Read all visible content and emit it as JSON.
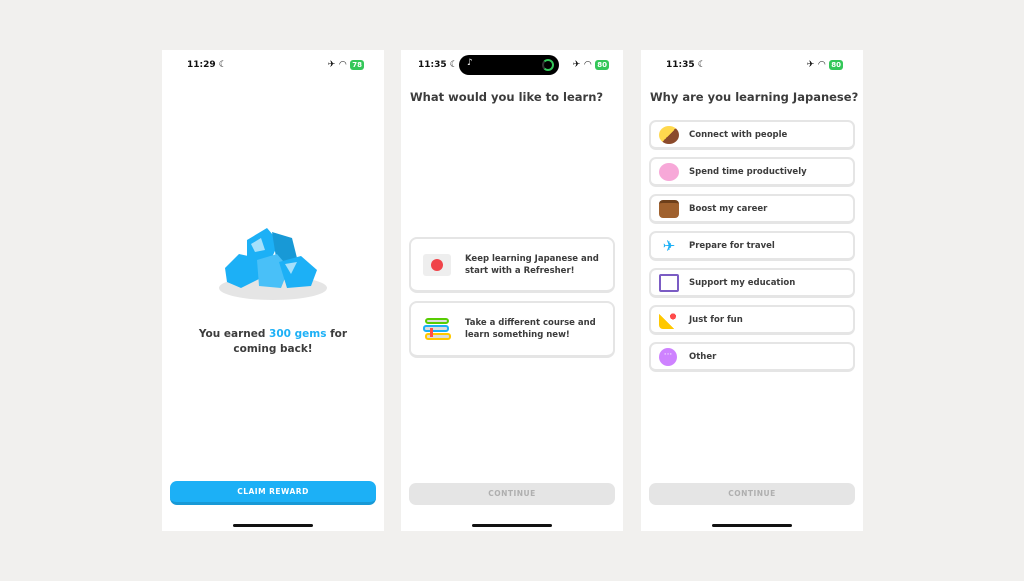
{
  "screens": [
    {
      "status": {
        "time": "11:29",
        "battery": "78"
      },
      "reward": {
        "prefix": "You earned ",
        "gems": "300 gems",
        "suffix": " for coming back!"
      },
      "claim_label": "CLAIM REWARD"
    },
    {
      "status": {
        "time": "11:35",
        "battery": "80"
      },
      "title": "What would you like to learn?",
      "options": [
        {
          "label": "Keep learning Japanese and start with a Refresher!",
          "icon": "japan-flag-icon"
        },
        {
          "label": "Take a different course and learn something new!",
          "icon": "books-icon"
        }
      ],
      "continue_label": "CONTINUE"
    },
    {
      "status": {
        "time": "11:35",
        "battery": "80"
      },
      "title": "Why are you learning Japanese?",
      "options": [
        {
          "label": "Connect with people",
          "icon": "people-icon"
        },
        {
          "label": "Spend time productively",
          "icon": "brain-icon"
        },
        {
          "label": "Boost my career",
          "icon": "briefcase-icon"
        },
        {
          "label": "Prepare for travel",
          "icon": "airplane-icon"
        },
        {
          "label": "Support my education",
          "icon": "book-icon"
        },
        {
          "label": "Just for fun",
          "icon": "party-popper-icon"
        },
        {
          "label": "Other",
          "icon": "more-icon"
        }
      ],
      "continue_label": "CONTINUE"
    }
  ],
  "colors": {
    "background": "#f1f0ee",
    "accent": "#1cb0f6",
    "disabled": "#e5e5e5",
    "battery": "#34c759"
  }
}
